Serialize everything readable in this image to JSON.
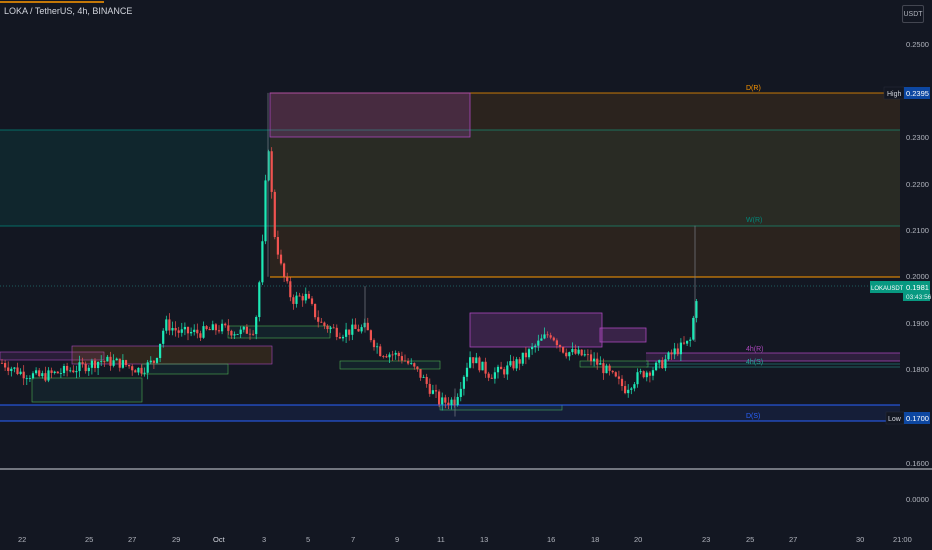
{
  "header": {
    "symbol_title": "LOKA / TetherUS, 4h, BINANCE",
    "currency": "USDT"
  },
  "price_scale": {
    "ticks": [
      "0.2500",
      "0.2400",
      "0.2300",
      "0.2200",
      "0.2100",
      "0.2000",
      "0.1900",
      "0.1800",
      "0.1700",
      "0.1600"
    ],
    "indicator_tick": "0.0000"
  },
  "time_scale": {
    "ticks": [
      "22",
      "25",
      "27",
      "29",
      "Oct",
      "3",
      "5",
      "7",
      "9",
      "11",
      "13",
      "16",
      "18",
      "20",
      "23",
      "25",
      "27",
      "30",
      "21:00"
    ]
  },
  "markers": {
    "high_label": "High",
    "high_value": "0.2395",
    "low_label": "Low",
    "low_value": "0.1700",
    "current_symbol": "LOKAUSDT",
    "current_price": "0.1981",
    "countdown": "03:43:56"
  },
  "zone_labels": {
    "d_r": "D(R)",
    "w_r": "W(R)",
    "h4_r": "4h(R)",
    "h4_s": "4h(S)",
    "d_s": "D(S)"
  },
  "colors": {
    "background": "#131722",
    "up": "#26a69a",
    "up_bright": "#1de9b6",
    "down": "#ef5350",
    "daily_zone": "#ff9800",
    "weekly_zone": "#00897b",
    "h4_zone": "#ab47bc",
    "support": "#2962ff",
    "current_price_bg": "#089981"
  },
  "chart_data": {
    "type": "candlestick",
    "symbol": "LOKA / TetherUS",
    "interval": "4h",
    "exchange": "BINANCE",
    "y_range": [
      0.155,
      0.255
    ],
    "high": 0.2395,
    "low": 0.17,
    "last": 0.1981,
    "levels": [
      {
        "label": "D(R)",
        "price": 0.2395
      },
      {
        "label": "W(R)",
        "price": 0.211
      },
      {
        "label": "4h(R)",
        "price": 0.1835
      },
      {
        "label": "4h(S)",
        "price": 0.181
      },
      {
        "label": "D(S)",
        "price": 0.17
      }
    ]
  }
}
